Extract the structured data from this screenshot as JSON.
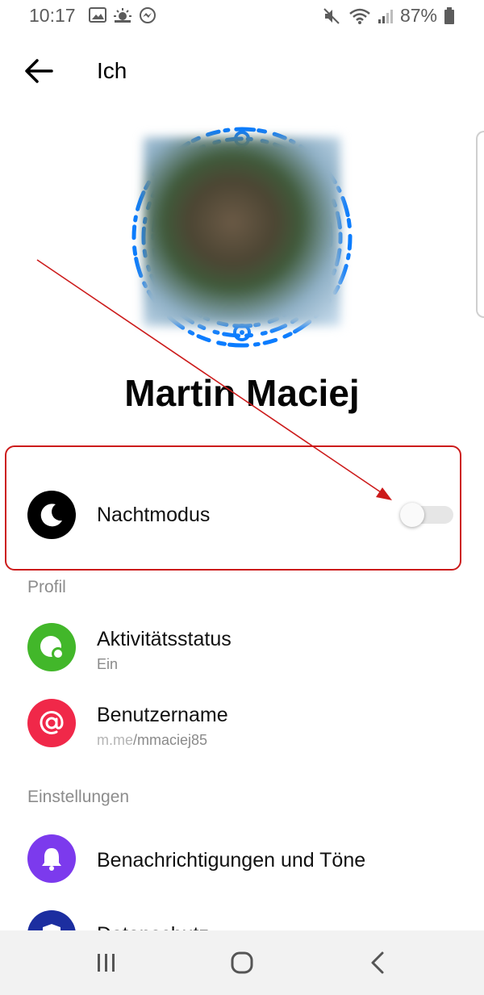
{
  "status_bar": {
    "time": "10:17",
    "battery": "87%",
    "left_icons": [
      "image-icon",
      "weather-icon",
      "messenger-icon"
    ],
    "right_icons": [
      "mute-icon",
      "wifi-icon",
      "signal-icon",
      "battery-icon"
    ]
  },
  "header": {
    "title": "Ich",
    "back_icon": "arrow-left-icon"
  },
  "profile": {
    "name": "Martin Maciej"
  },
  "night_mode": {
    "label": "Nachtmodus",
    "icon": "moon-icon",
    "enabled": false
  },
  "sections": {
    "profile": {
      "header": "Profil",
      "items": [
        {
          "title": "Aktivitätsstatus",
          "subtitle": "Ein",
          "icon": "activity-status-icon",
          "color": "#42b72a"
        },
        {
          "title": "Benutzername",
          "subtitle_prefix": "m.me",
          "subtitle_value": "/mmaciej85",
          "icon": "at-icon",
          "color": "#f02849"
        }
      ]
    },
    "settings": {
      "header": "Einstellungen",
      "items": [
        {
          "title": "Benachrichtigungen und Töne",
          "icon": "bell-icon",
          "color": "#7c3aed"
        },
        {
          "title": "Datenschutz",
          "icon": "shield-icon",
          "color": "#1c2ea0"
        }
      ]
    }
  },
  "colors": {
    "highlight": "#cc1b1b",
    "accent": "#0084ff",
    "arrow": "#cc1b1b"
  },
  "nav_bar": {
    "icons": [
      "recent-apps-icon",
      "home-icon",
      "back-nav-icon"
    ]
  }
}
